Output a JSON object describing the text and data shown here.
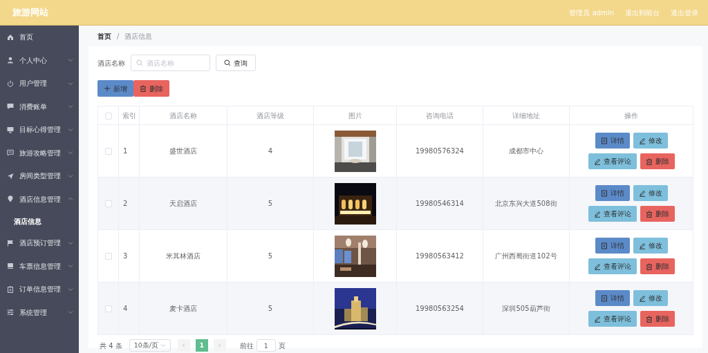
{
  "header": {
    "title": "旅游网站",
    "links": [
      "管理员 admin",
      "退出到前台",
      "退出登录"
    ]
  },
  "sidebar": {
    "items": [
      {
        "label": "首页",
        "kind": "link"
      },
      {
        "label": "个人中心",
        "kind": "group",
        "expanded": false
      },
      {
        "label": "用户管理",
        "kind": "group",
        "expanded": false
      },
      {
        "label": "消费账单",
        "kind": "group",
        "expanded": false
      },
      {
        "label": "目标心得管理",
        "kind": "group",
        "expanded": false
      },
      {
        "label": "旅游攻略管理",
        "kind": "group",
        "expanded": false
      },
      {
        "label": "房间类型管理",
        "kind": "group",
        "expanded": false
      },
      {
        "label": "酒店信息管理",
        "kind": "group",
        "expanded": true,
        "children": [
          {
            "label": "酒店信息",
            "selected": true
          }
        ]
      },
      {
        "label": "酒店预订管理",
        "kind": "group",
        "expanded": false
      },
      {
        "label": "车票信息管理",
        "kind": "group",
        "expanded": false
      },
      {
        "label": "订单信息管理",
        "kind": "group",
        "expanded": false
      },
      {
        "label": "系统管理",
        "kind": "group",
        "expanded": false
      }
    ]
  },
  "breadcrumb": {
    "separator": "/",
    "items": [
      "首页",
      "酒店信息"
    ]
  },
  "search": {
    "label": "酒店名称",
    "placeholder": "酒店名称",
    "button": "查询"
  },
  "toolbar": [
    {
      "label": "新增",
      "kind": "add"
    },
    {
      "label": "删除",
      "kind": "delete"
    }
  ],
  "table": {
    "all_checked": false,
    "columns": [
      "索引",
      "酒店名称",
      "酒店等级",
      "图片",
      "咨询电话",
      "详细地址",
      "操作"
    ],
    "rows": [
      {
        "checked": false,
        "index": "1",
        "name": "盛世酒店",
        "grade": "4",
        "phone": "19980576324",
        "address": "成都市中心",
        "actions": [
          {
            "label": "详情",
            "kind": "detail"
          },
          {
            "label": "修改",
            "kind": "edit"
          },
          {
            "label": "查看评论",
            "kind": "review"
          },
          {
            "label": "删除",
            "kind": "delete"
          }
        ]
      },
      {
        "checked": false,
        "index": "2",
        "name": "天启酒店",
        "grade": "5",
        "phone": "19980546314",
        "address": "北京东兴大道508街",
        "actions": [
          {
            "label": "详情",
            "kind": "detail"
          },
          {
            "label": "修改",
            "kind": "edit"
          },
          {
            "label": "查看评论",
            "kind": "review"
          },
          {
            "label": "删除",
            "kind": "delete"
          }
        ]
      },
      {
        "checked": false,
        "index": "3",
        "name": "米其林酒店",
        "grade": "5",
        "phone": "19980563412",
        "address": "广州西蜀街道102号",
        "actions": [
          {
            "label": "详情",
            "kind": "detail"
          },
          {
            "label": "修改",
            "kind": "edit"
          },
          {
            "label": "查看评论",
            "kind": "review"
          },
          {
            "label": "删除",
            "kind": "delete"
          }
        ]
      },
      {
        "checked": false,
        "index": "4",
        "name": "麦卡酒店",
        "grade": "5",
        "phone": "19980563254",
        "address": "深圳505葫芦街",
        "actions": [
          {
            "label": "详情",
            "kind": "detail"
          },
          {
            "label": "修改",
            "kind": "edit"
          },
          {
            "label": "查看评论",
            "kind": "review"
          },
          {
            "label": "删除",
            "kind": "delete"
          }
        ]
      }
    ]
  },
  "pagination": {
    "total": "共 4 条",
    "page_size": "10条/页",
    "prev": "‹",
    "pages": [
      {
        "label": "1",
        "selected": true
      }
    ],
    "next": "›",
    "goto_label": "前往",
    "goto_value": "1",
    "goto_suffix": "页"
  }
}
